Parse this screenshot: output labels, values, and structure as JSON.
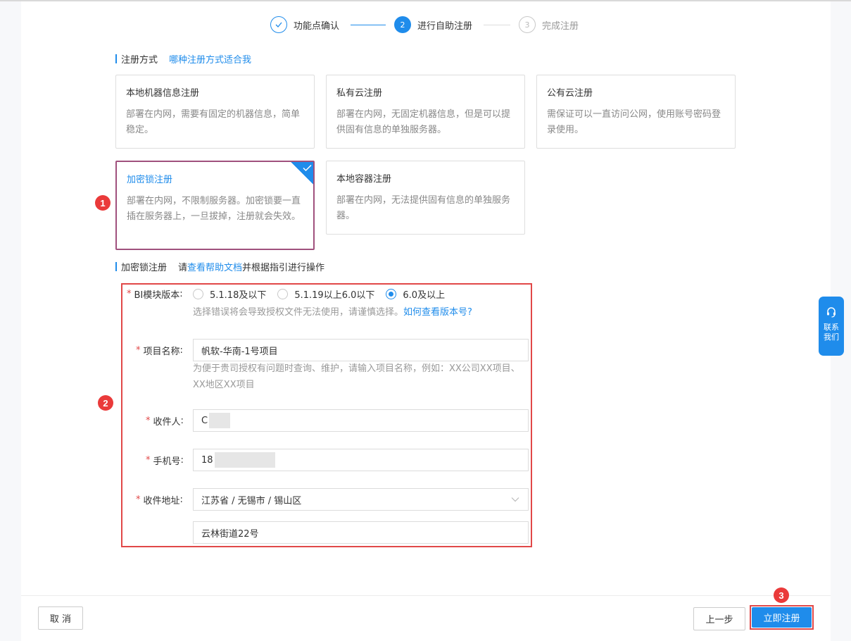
{
  "steps": [
    {
      "num": "✓",
      "label": "功能点确认"
    },
    {
      "num": "2",
      "label": "进行自助注册"
    },
    {
      "num": "3",
      "label": "完成注册"
    }
  ],
  "method_section": {
    "title": "注册方式",
    "help_link": "哪种注册方式适合我"
  },
  "cards": [
    {
      "title": "本地机器信息注册",
      "desc": "部署在内网，需要有固定的机器信息，简单稳定。"
    },
    {
      "title": "私有云注册",
      "desc": "部署在内网，无固定机器信息，但是可以提供固有信息的单独服务器。"
    },
    {
      "title": "公有云注册",
      "desc": "需保证可以一直访问公网，使用账号密码登录使用。"
    },
    {
      "title": "加密锁注册",
      "desc": "部署在内网，不限制服务器。加密锁要一直插在服务器上，一旦拔掉，注册就会失效。",
      "selected": true
    },
    {
      "title": "本地容器注册",
      "desc": "部署在内网，无法提供固有信息的单独服务器。"
    }
  ],
  "detail_section": {
    "title": "加密锁注册",
    "pre": "请",
    "link": "查看帮助文档",
    "post": "并根据指引进行操作"
  },
  "form": {
    "version": {
      "label": "BI模块版本",
      "options": [
        "5.1.18及以下",
        "5.1.19以上6.0以下",
        "6.0及以上"
      ],
      "selected": "6.0及以上",
      "hint": "选择错误将会导致授权文件无法使用，请谨慎选择。",
      "hint_link": "如何查看版本号?"
    },
    "project": {
      "label": "项目名称",
      "value": "帆软-华南-1号项目",
      "hint": "为便于贵司授权有问题时查询、维护，请输入项目名称，例如：XX公司XX项目、XX地区XX项目"
    },
    "receiver": {
      "label": "收件人",
      "value": "C"
    },
    "phone": {
      "label": "手机号",
      "value": "18"
    },
    "address": {
      "label": "收件地址",
      "region": "江苏省 / 无锡市 / 锡山区",
      "street": "云林街道22号"
    }
  },
  "annotations": [
    "1",
    "2",
    "3"
  ],
  "footer": {
    "cancel": "取 消",
    "prev": "上一步",
    "submit": "立即注册"
  },
  "contact": {
    "line1": "联系",
    "line2": "我们"
  },
  "colors": {
    "accent": "#1f8ceb",
    "annotation": "#e14848",
    "selected_border": "#a0517d"
  }
}
